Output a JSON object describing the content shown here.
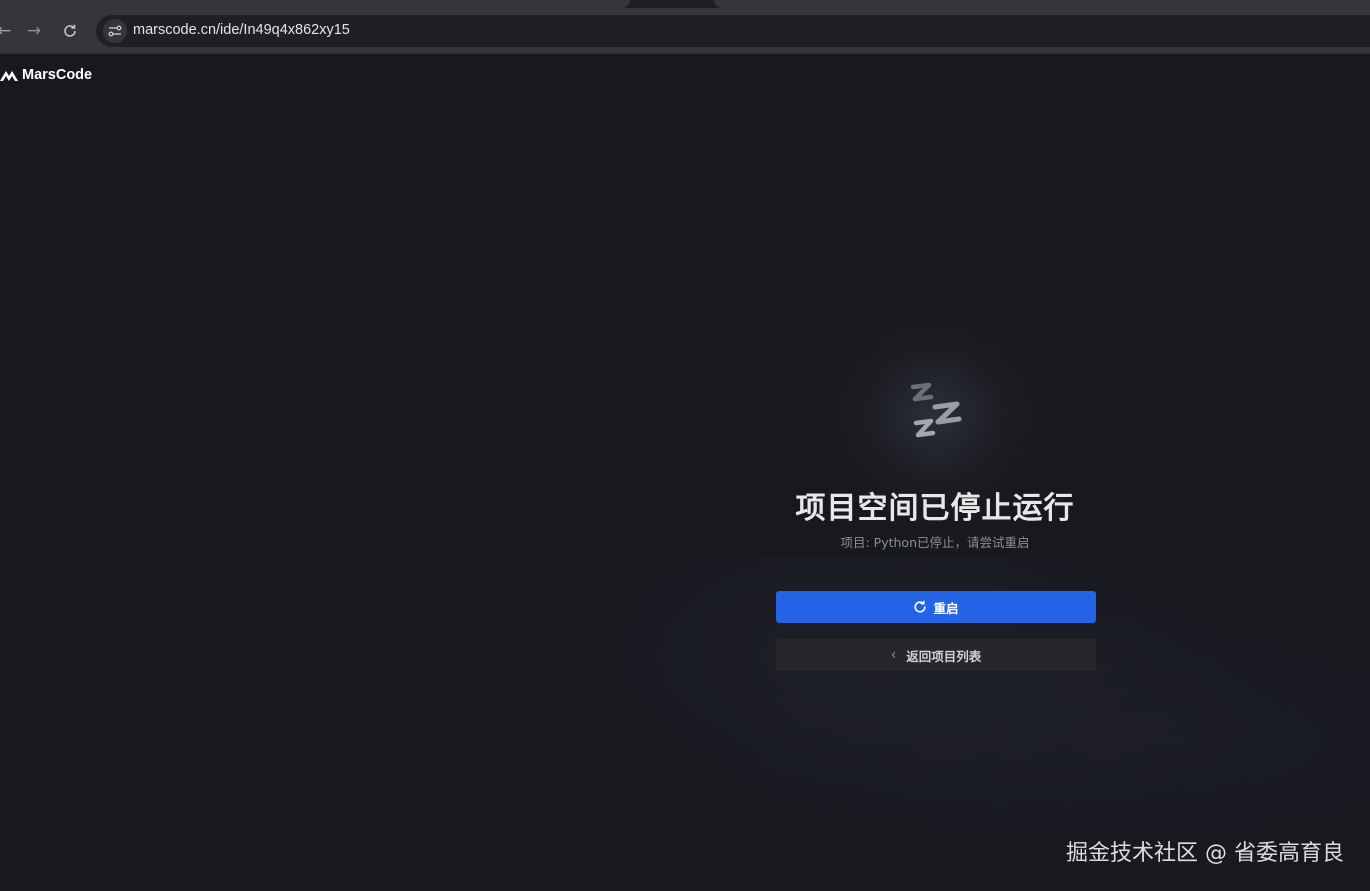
{
  "browser": {
    "url": "marscode.cn/ide/In49q4x862xy15",
    "icons": [
      "back-arrow-icon",
      "forward-arrow-icon",
      "reload-icon",
      "site-settings-icon"
    ]
  },
  "header": {
    "logo_text": "MarsCode"
  },
  "main": {
    "title": "项目空间已停止运行",
    "subtitle": "项目: Python已停止，请尝试重启",
    "restart_label": "重启",
    "back_label": "返回项目列表"
  },
  "watermark": "掘金技术社区 @ 省委高育良",
  "colors": {
    "background": "#18191d",
    "primary_button": "#2463e3",
    "secondary_button": "#26272b"
  }
}
